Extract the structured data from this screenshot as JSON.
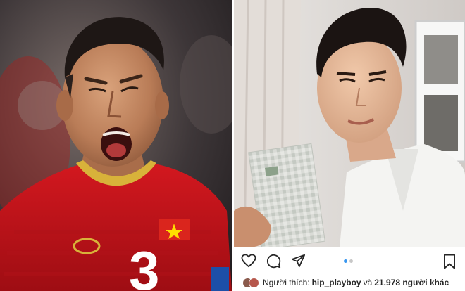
{
  "instagram": {
    "likes_prefix": "Người thích:",
    "liker_username": "hip_playboy",
    "likes_conjunction": "và",
    "likes_others": "21.978 người khác"
  },
  "jersey": {
    "number": "3"
  },
  "colors": {
    "jersey_red": "#c8141b",
    "icon_dark": "#262626",
    "dot_active": "#3897f0"
  }
}
